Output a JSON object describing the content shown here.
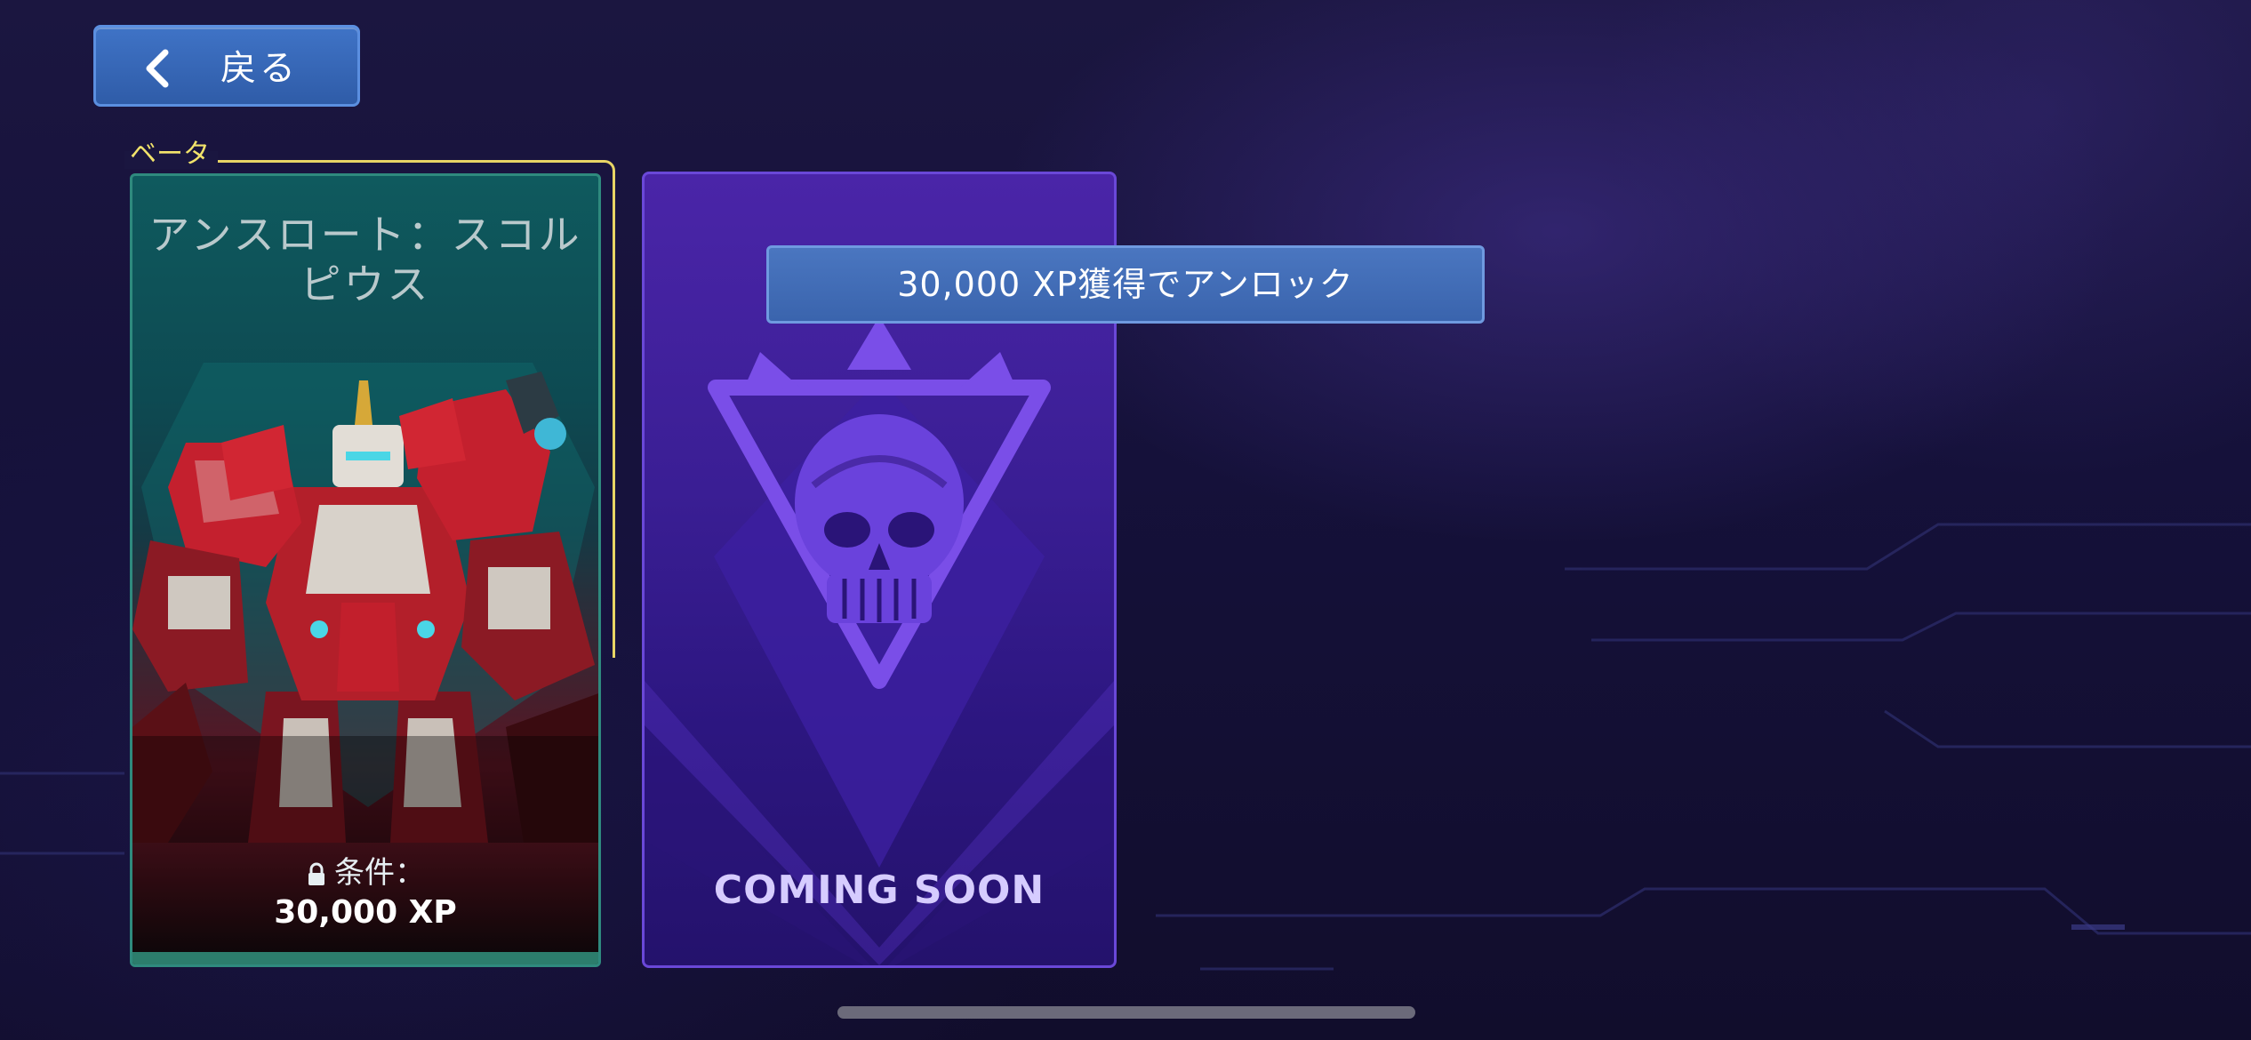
{
  "back_button": {
    "label": "戻る",
    "icon": "chevron-left-icon"
  },
  "beta_label": "ベータ",
  "character_card": {
    "title": "アンスロート：スコル\nピウス",
    "condition_label": "条件：",
    "condition_value": "30,000 XP",
    "lock_icon": "lock-icon"
  },
  "locked_card": {
    "status": "COMING SOON",
    "emblem": "skull-emblem-icon"
  },
  "tooltip": {
    "text": "30,000 XP獲得でアンロック"
  },
  "colors": {
    "beta_accent": "#e8d565",
    "button_blue": "#3f73c6",
    "locked_purple": "#3a1e94",
    "card_teal": "#0f5a5e"
  }
}
